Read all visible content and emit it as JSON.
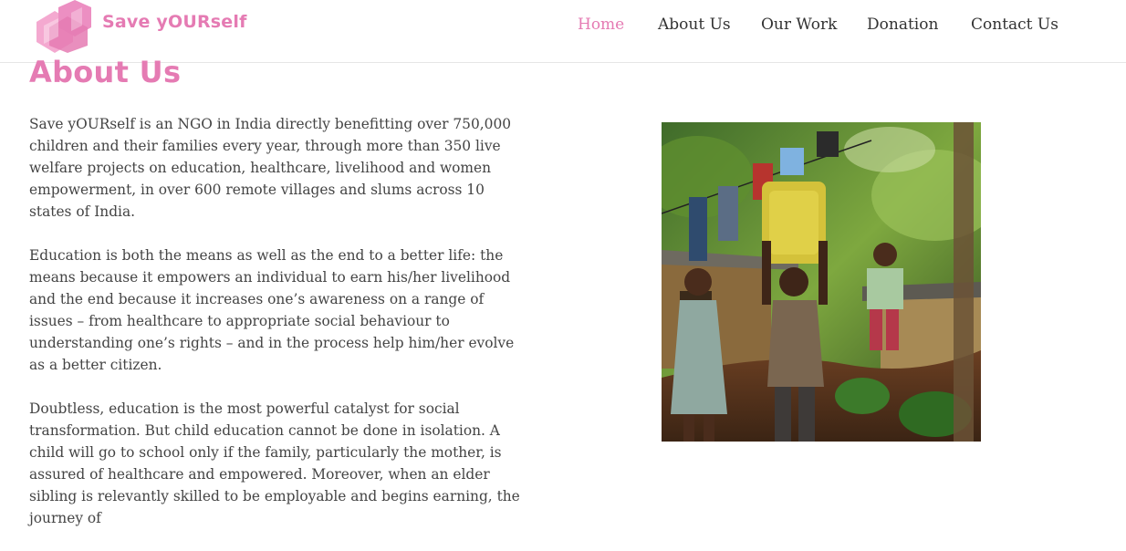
{
  "brand": {
    "name": "Save yOURself",
    "colors": {
      "accent": "#e57bb3",
      "logo_light": "#f4a9d0",
      "logo_dark": "#e57bb3"
    }
  },
  "nav": {
    "items": [
      {
        "label": "Home",
        "active": true
      },
      {
        "label": "About Us",
        "active": false
      },
      {
        "label": "Our Work",
        "active": false
      },
      {
        "label": "Donation",
        "active": false
      },
      {
        "label": "Contact Us",
        "active": false
      }
    ]
  },
  "main": {
    "title": "About Us",
    "paragraphs": [
      "Save yOURself is an NGO in India directly benefitting over 750,000 children and their families every year, through more than 350 live welfare projects on education, healthcare, livelihood and women empowerment, in over 600 remote villages and slums across 10 states of India.",
      "Education is both the means as well as the end to a better life: the means because it empowers an individual to earn his/her livelihood and the end because it increases one’s awareness on a range of issues – from healthcare to appropriate social behaviour to understanding one’s rights – and in the process help him/her evolve as a better citizen.",
      "Doubtless, education is the most powerful catalyst for social transformation. But child education cannot be done in isolation. A child will go to school only if the family, particularly the mother, is assured of healthcare and empowered. Moreover, when an elder sibling is relevantly skilled to be employable and begins earning, the journey of"
    ]
  }
}
